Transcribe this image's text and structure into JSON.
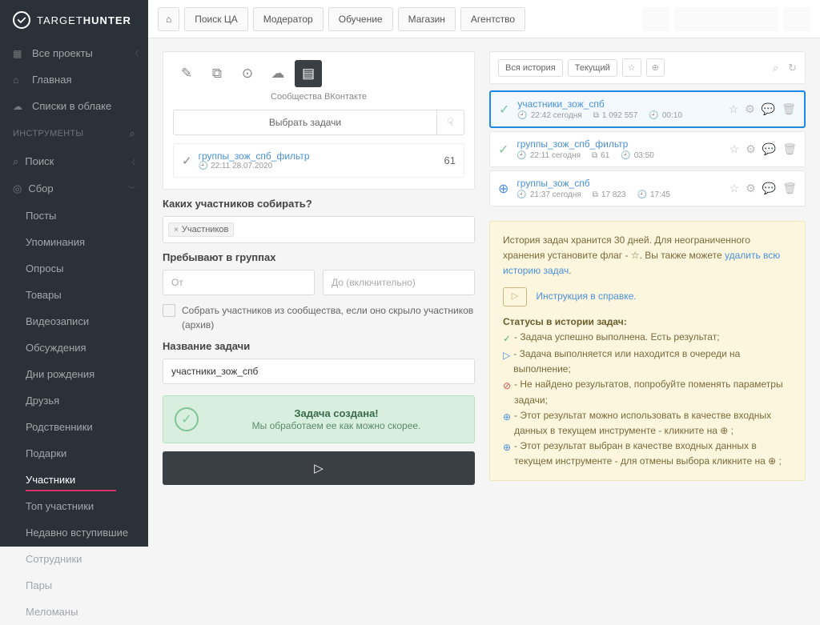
{
  "brand": {
    "thin": "TARGET",
    "bold": "HUNTER"
  },
  "topnav": {
    "home": "⌂",
    "items": [
      "Поиск ЦА",
      "Модератор",
      "Обучение",
      "Магазин",
      "Агентство"
    ]
  },
  "sidebar": {
    "projects": "Все проекты",
    "main": "Главная",
    "cloud": "Списки в облаке",
    "tools_header": "ИНСТРУМЕНТЫ",
    "search": "Поиск",
    "gather": "Сбор",
    "gather_items": [
      "Посты",
      "Упоминания",
      "Опросы",
      "Товары",
      "Видеозаписи",
      "Обсуждения",
      "Дни рождения",
      "Друзья",
      "Родственники",
      "Подарки",
      "Участники",
      "Топ участники",
      "Недавно вступившие",
      "Сотрудники",
      "Пары",
      "Меломаны"
    ],
    "active_index": 10
  },
  "form": {
    "tab_caption": "Сообщества ВКонтакте",
    "choose_tasks": "Выбрать задачи",
    "loaded_task": {
      "name": "группы_зож_спб_фильтр",
      "meta": "22:11 28.07.2020",
      "count": "61"
    },
    "q_who": "Каких участников собирать?",
    "tag_members": "Участников",
    "q_stay": "Пребывают в группах",
    "from_ph": "От",
    "to_ph": "До (включительно)",
    "archive_checkbox": "Собрать участников из сообщества, если оно скрыло участников (архив)",
    "task_name_label": "Название задачи",
    "task_name_value": "участники_зож_спб",
    "success_title": "Задача создана!",
    "success_sub": "Мы обработаем ее как можно скорее."
  },
  "history": {
    "tab_all": "Вся история",
    "tab_current": "Текущий",
    "items": [
      {
        "status": "ok",
        "title": "участники_зож_спб",
        "time": "22:42 сегодня",
        "count": "1 092 557",
        "dur": "00:10",
        "selected": true
      },
      {
        "status": "ok",
        "title": "группы_зож_спб_фильтр",
        "time": "22:11 сегодня",
        "count": "61",
        "dur": "03:50",
        "selected": false
      },
      {
        "status": "plus",
        "title": "группы_зож_спб",
        "time": "21:37 сегодня",
        "count": "17 823",
        "dur": "17:45",
        "selected": false
      }
    ]
  },
  "notice": {
    "line1a": "История задач хранится 30 дней. Для неограниченного хранения установите флаг - ",
    "line1b": ". Вы также можете ",
    "delete_link": "удалить всю историю задач",
    "instr_link": "Инструкция в справке.",
    "statuses_header": "Статусы в истории задач:",
    "s_ok": " - Задача успешно выполнена. Есть результат;",
    "s_wait": " - Задача выполняется или находится в очереди на выполнение;",
    "s_err": " - Не найдено результатов, попробуйте поменять параметры задачи;",
    "s_use1": " - Этот результат можно использовать в качестве входных данных в текущем инструменте - кликните на ",
    "s_use2": " - Этот результат выбран в качестве входных данных в текущем инструменте - для отмены выбора кликните на "
  }
}
